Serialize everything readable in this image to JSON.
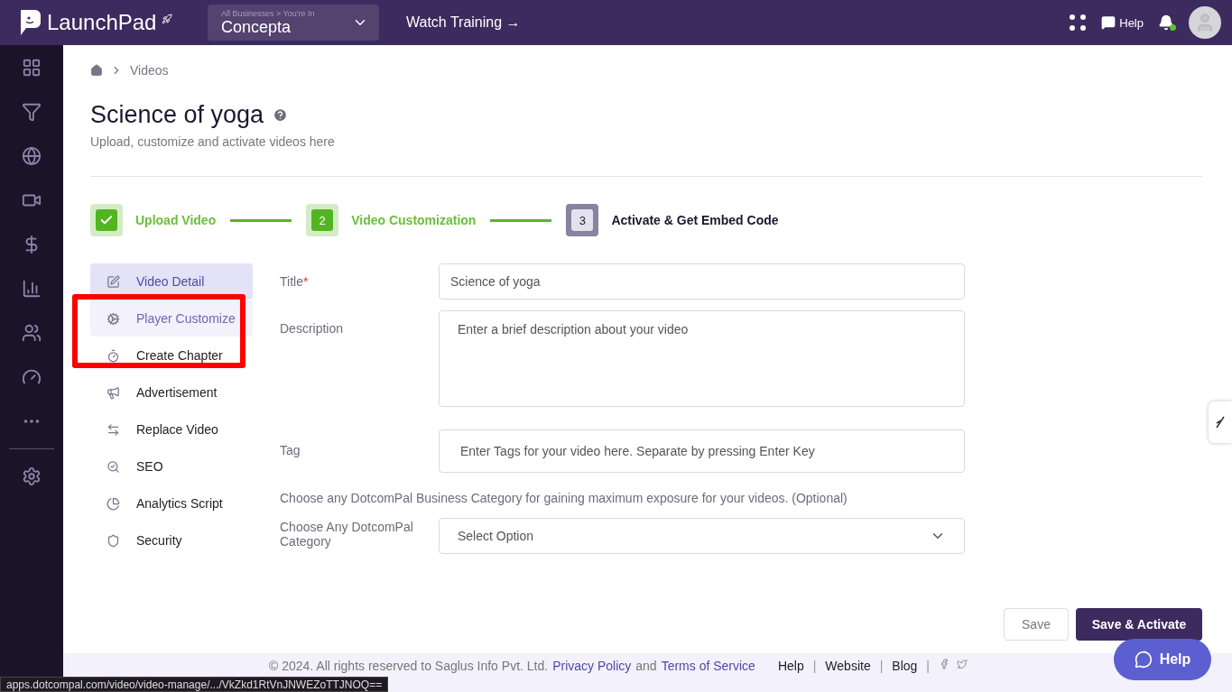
{
  "topbar": {
    "brand": "LaunchPad",
    "business_crumb": "All Businesses > You're In",
    "business": "Concepta",
    "watch_training": "Watch Training →",
    "help": "Help",
    "notification_dot": true
  },
  "breadcrumb": [
    "Videos"
  ],
  "page": {
    "title": "Science of yoga",
    "subtitle": "Upload, customize and activate videos here"
  },
  "steps": [
    {
      "label": "Upload Video",
      "kind": "done"
    },
    {
      "number": "2",
      "label": "Video Customization",
      "kind": "current"
    },
    {
      "number": "3",
      "label": "Activate & Get Embed Code",
      "kind": "pending"
    }
  ],
  "menu": [
    {
      "label": "Video Detail",
      "selected": true,
      "hovered": false
    },
    {
      "label": "Player Customize",
      "selected": false,
      "hovered": true
    },
    {
      "label": "Create Chapter",
      "selected": false,
      "hovered": false
    },
    {
      "label": "Advertisement",
      "selected": false,
      "hovered": false
    },
    {
      "label": "Replace Video",
      "selected": false,
      "hovered": false
    },
    {
      "label": "SEO",
      "selected": false,
      "hovered": false
    },
    {
      "label": "Analytics Script",
      "selected": false,
      "hovered": false
    },
    {
      "label": "Security",
      "selected": false,
      "hovered": false
    }
  ],
  "form": {
    "title": {
      "label": "Title",
      "required_mark": "*",
      "value": "Science of yoga"
    },
    "description": {
      "label": "Description",
      "placeholder": "Enter a brief description about your video"
    },
    "tag": {
      "label": "Tag",
      "placeholder": "Enter Tags for your video here. Separate by pressing Enter Key"
    },
    "category_note": "Choose any DotcomPal Business Category for gaining maximum exposure for your videos. (Optional)",
    "category": {
      "label": "Choose Any DotcomPal Category",
      "placeholder": "Select Option"
    }
  },
  "actions": {
    "save": "Save",
    "save_activate": "Save & Activate"
  },
  "footer": {
    "copyright": "© 2024. All rights reserved to Saglus Info Pvt. Ltd.",
    "privacy": "Privacy Policy",
    "and": "and",
    "terms": "Terms of Service",
    "links": [
      {
        "label": "Help",
        "separator": "|"
      },
      {
        "label": "Website",
        "separator": "|"
      },
      {
        "label": "Blog",
        "separator": "|"
      }
    ]
  },
  "help_button": "Help",
  "status_url": "apps.dotcompal.com/video/video-manage/.../VkZkd1RtVnJNWEZoTTJNOQ=="
}
